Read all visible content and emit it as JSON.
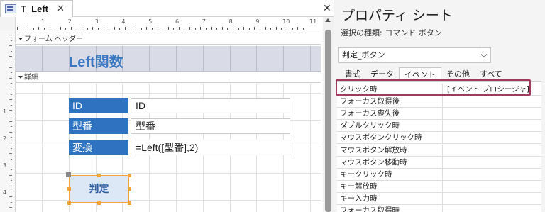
{
  "designer": {
    "tab_label": "T_Left",
    "tab_close": "✕",
    "pane_close": "✕",
    "ruler_numbers": [
      "1",
      "2",
      "3",
      "4",
      "5",
      "6",
      "7",
      "8",
      "9",
      "10",
      "11"
    ],
    "vruler_numbers": [
      "1",
      "2",
      "3",
      "4"
    ],
    "form_header_label": "フォーム ヘッダー",
    "detail_label": "詳細",
    "form_title": "Left関数",
    "fields": [
      {
        "label": "ID",
        "value": "ID"
      },
      {
        "label": "型番",
        "value": "型番"
      },
      {
        "label": "変換",
        "value": "=Left([型番],2)"
      }
    ],
    "button_label": "判定"
  },
  "property_sheet": {
    "title": "プロパティ シート",
    "selection_type": "選択の種類:  コマンド ボタン",
    "object_name": "判定_ボタン",
    "tabs": [
      "書式",
      "データ",
      "イベント",
      "その他",
      "すべて"
    ],
    "active_tab": "イベント",
    "rows": [
      {
        "name": "クリック時",
        "value": "[イベント プロシージャ]"
      },
      {
        "name": "フォーカス取得後",
        "value": ""
      },
      {
        "name": "フォーカス喪失後",
        "value": ""
      },
      {
        "name": "ダブルクリック時",
        "value": ""
      },
      {
        "name": "マウスボタンクリック時",
        "value": ""
      },
      {
        "name": "マウスボタン解放時",
        "value": ""
      },
      {
        "name": "マウスボタン移動時",
        "value": ""
      },
      {
        "name": "キークリック時",
        "value": ""
      },
      {
        "name": "キー解放時",
        "value": ""
      },
      {
        "name": "キー入力時",
        "value": ""
      },
      {
        "name": "フォーカス取得時",
        "value": ""
      }
    ]
  },
  "colors": {
    "accent": "#2f73c0",
    "highlight": "#a33a5c",
    "selection_handle": "#f2a33c"
  }
}
